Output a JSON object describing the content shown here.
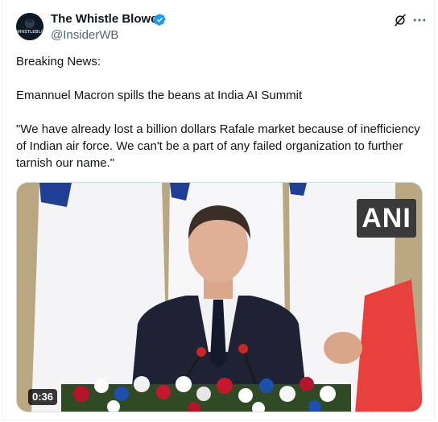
{
  "author": {
    "name": "The Whistle Blower",
    "handle": "@InsiderWB",
    "avatar_text": "WHISTLEBLOWER"
  },
  "tweet": {
    "line1": "Breaking News:",
    "line2": "Emannuel Macron spills the beans at India AI Summit",
    "line3": "\"We have already lost a billion dollars Rafale market because of inefficiency of Indian air force. We can't be a part of any failed organization to further tarnish our name.\""
  },
  "media": {
    "watermark": "ANI",
    "duration": "0:36"
  },
  "icons": {
    "verified": "verified-badge-icon",
    "grok": "grok-icon",
    "more": "more-options-icon"
  },
  "colors": {
    "verified_blue": "#1d9bf0",
    "text_primary": "#0f1419",
    "text_secondary": "#536471"
  }
}
